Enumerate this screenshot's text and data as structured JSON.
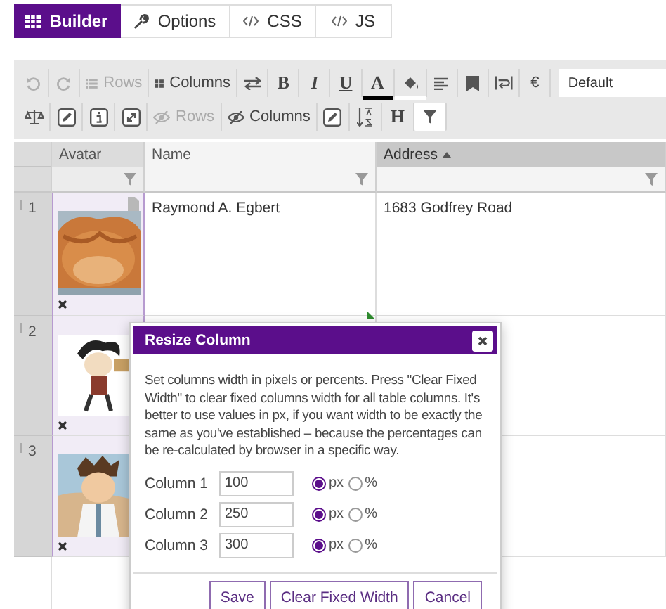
{
  "tabs": [
    {
      "label": "Builder",
      "selected": true
    },
    {
      "label": "Options",
      "selected": false
    },
    {
      "label": "CSS",
      "selected": false
    },
    {
      "label": "JS",
      "selected": false
    }
  ],
  "toolbar": {
    "rows": [
      {
        "items": [
          {
            "kind": "icon",
            "disabled": true,
            "pressed": false
          },
          {
            "kind": "icon",
            "disabled": true,
            "pressed": false
          },
          {
            "kind": "labeled",
            "text": "Rows",
            "disabled": true,
            "pressed": false
          },
          {
            "kind": "labeled",
            "text": "Columns",
            "disabled": false,
            "pressed": false
          },
          {
            "kind": "icon",
            "disabled": false,
            "pressed": false
          },
          {
            "kind": "glyph",
            "text": "B",
            "disabled": false,
            "pressed": false
          },
          {
            "kind": "glyph",
            "text": "I",
            "disabled": false,
            "pressed": false
          },
          {
            "kind": "glyph",
            "text": "U",
            "disabled": false,
            "pressed": false
          },
          {
            "kind": "glyph",
            "text": "A",
            "color": "#000000",
            "disabled": false,
            "pressed": false
          },
          {
            "kind": "icon",
            "color": "#ffffff",
            "disabled": false,
            "pressed": false
          },
          {
            "kind": "icon",
            "disabled": false,
            "pressed": false
          },
          {
            "kind": "icon",
            "disabled": false,
            "pressed": false
          },
          {
            "kind": "icon",
            "disabled": false,
            "pressed": false
          },
          {
            "kind": "symbol",
            "text": "€",
            "disabled": false,
            "pressed": false
          }
        ]
      },
      {
        "items": [
          {
            "kind": "icon",
            "disabled": false,
            "pressed": false
          },
          {
            "kind": "icon",
            "disabled": false,
            "pressed": false
          },
          {
            "kind": "icon",
            "disabled": false,
            "pressed": false
          },
          {
            "kind": "icon",
            "disabled": false,
            "pressed": false
          },
          {
            "kind": "labeled",
            "text": "Rows",
            "disabled": true,
            "pressed": false
          },
          {
            "kind": "labeled",
            "text": "Columns",
            "disabled": false,
            "pressed": false
          },
          {
            "kind": "icon",
            "disabled": false,
            "pressed": false
          },
          {
            "kind": "icon",
            "disabled": false,
            "pressed": false
          },
          {
            "kind": "glyph",
            "text": "H",
            "disabled": false,
            "pressed": false
          },
          {
            "kind": "icon",
            "disabled": false,
            "pressed": true
          }
        ]
      }
    ],
    "style_select": {
      "value": "Default"
    }
  },
  "table": {
    "columns": [
      {
        "label": "Avatar",
        "selected": true,
        "sorted": false
      },
      {
        "label": "Name",
        "selected": false,
        "sorted": false
      },
      {
        "label": "Address",
        "selected": false,
        "sorted": true
      }
    ],
    "rows": [
      {
        "number": "1",
        "name": "Raymond A. Egbert",
        "address": "1683 Godfrey Road",
        "has_note": true
      },
      {
        "number": "2",
        "has_note": false
      },
      {
        "number": "3",
        "has_note": false
      }
    ]
  },
  "dialog": {
    "title": "Resize Column",
    "text": "Set columns width in pixels or percents. Press \"Clear Fixed Width\" to clear fixed columns width for all table columns. It's better to use values in px, if you want width to be exactly the same as you've established – because the percentages can be re-calculated by browser in a specific way.",
    "fields": [
      {
        "label": "Column 1",
        "value": "100",
        "units": [
          {
            "label": "px",
            "selected": true
          },
          {
            "label": "%",
            "selected": false
          }
        ]
      },
      {
        "label": "Column 2",
        "value": "250",
        "units": [
          {
            "label": "px",
            "selected": true
          },
          {
            "label": "%",
            "selected": false
          }
        ]
      },
      {
        "label": "Column 3",
        "value": "300",
        "units": [
          {
            "label": "px",
            "selected": true
          },
          {
            "label": "%",
            "selected": false
          }
        ]
      }
    ],
    "buttons": [
      "Save",
      "Clear Fixed Width",
      "Cancel"
    ]
  }
}
